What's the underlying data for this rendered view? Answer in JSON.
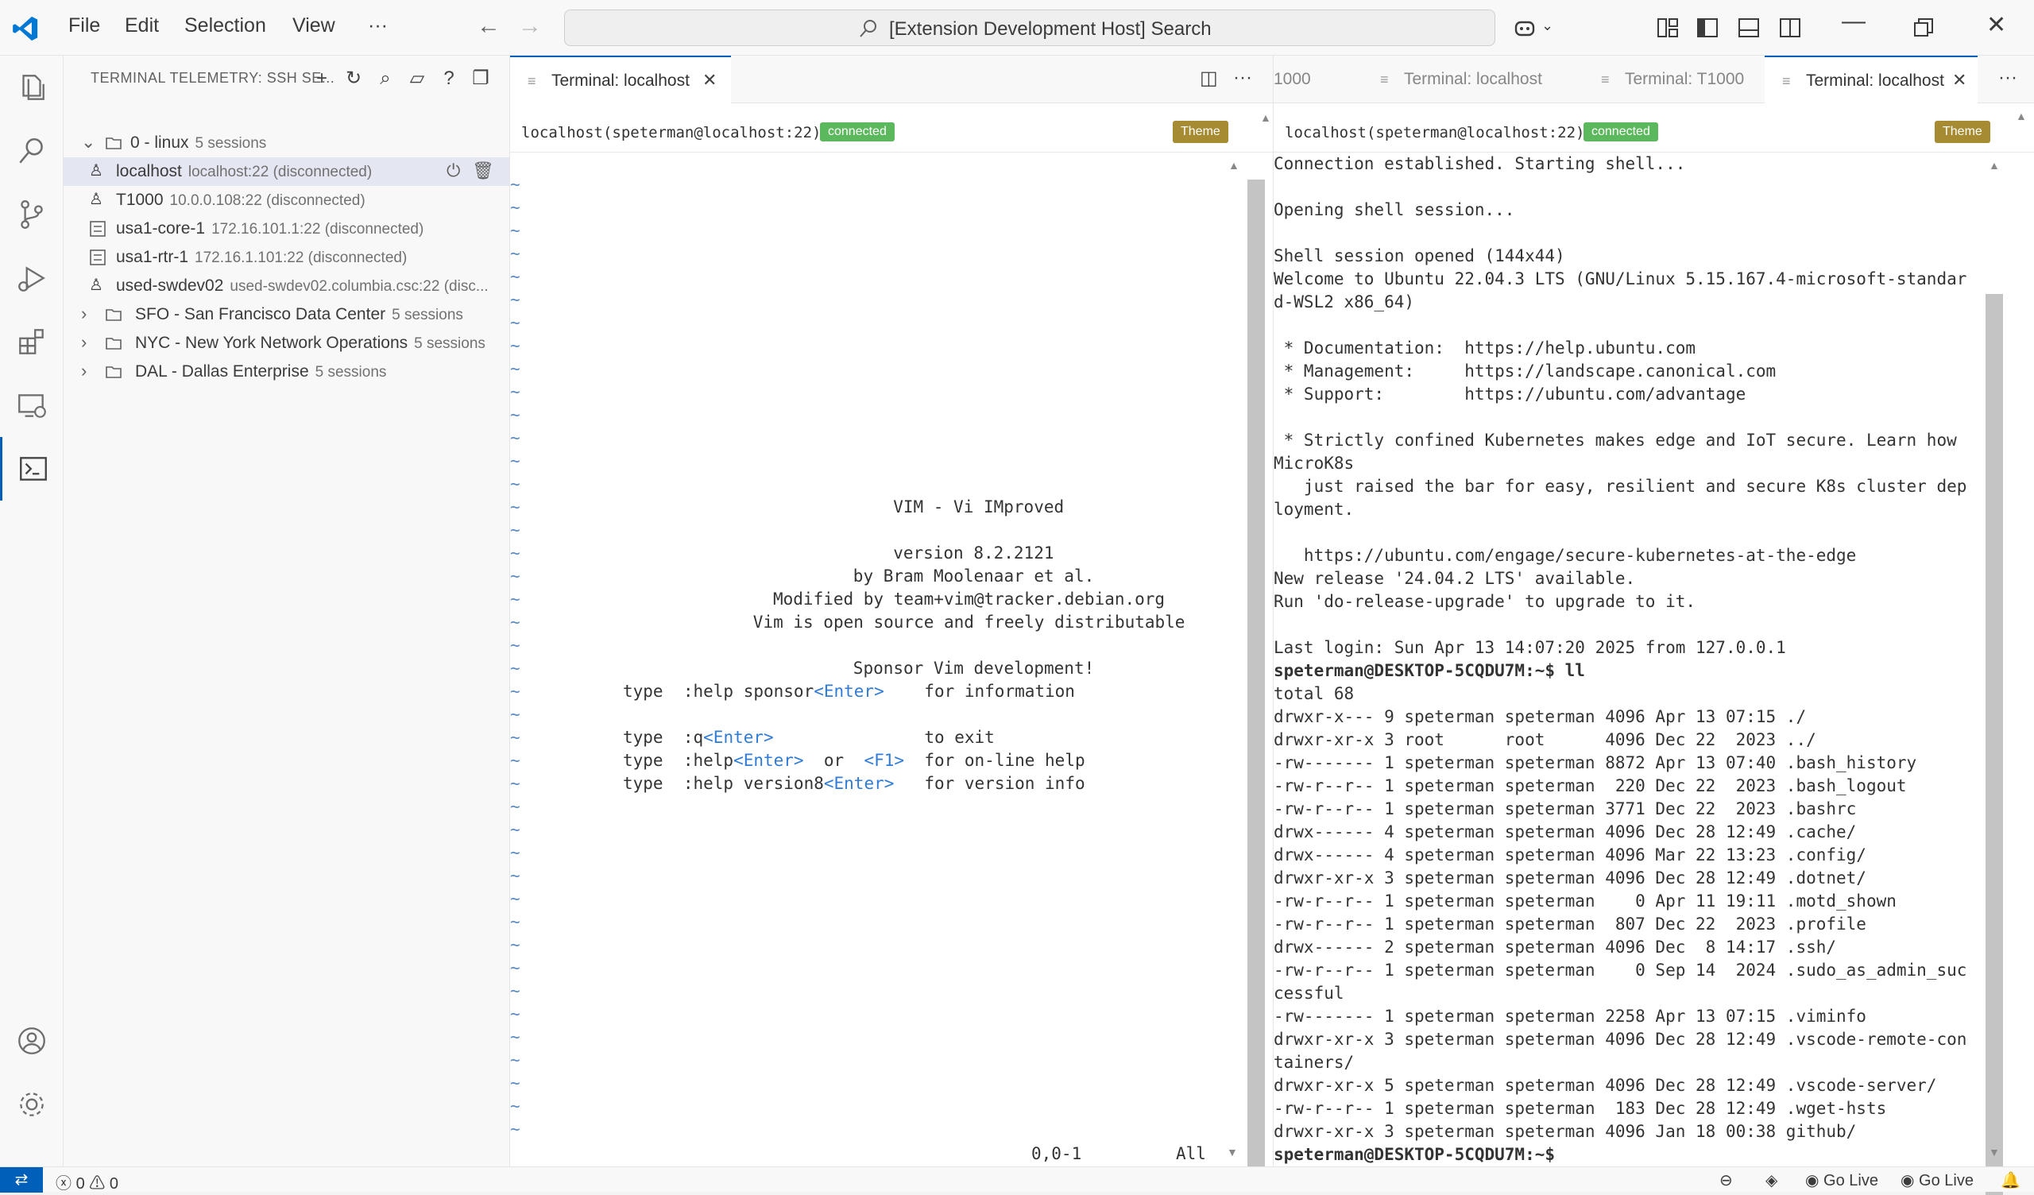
{
  "titlebar": {
    "menus": [
      "File",
      "Edit",
      "Selection",
      "View",
      "···"
    ],
    "search_text": "[Extension Development Host] Search"
  },
  "sidebar": {
    "title": "TERMINAL TELEMETRY: SSH SE...",
    "tree": [
      {
        "label": "0 - linux",
        "desc": "5 sessions",
        "type": "folder",
        "expanded": true
      },
      {
        "label": "localhost",
        "desc": "localhost:22 (disconnected)",
        "type": "linux",
        "selected": true
      },
      {
        "label": "T1000",
        "desc": "10.0.0.108:22 (disconnected)",
        "type": "linux"
      },
      {
        "label": "usa1-core-1",
        "desc": "172.16.101.1:22 (disconnected)",
        "type": "router"
      },
      {
        "label": "usa1-rtr-1",
        "desc": "172.16.1.101:22 (disconnected)",
        "type": "router"
      },
      {
        "label": "used-swdev02",
        "desc": "used-swdev02.columbia.csc:22 (disc...",
        "type": "linux"
      },
      {
        "label": "SFO - San Francisco Data Center",
        "desc": "5 sessions",
        "type": "folder"
      },
      {
        "label": "NYC - New York Network Operations",
        "desc": "5 sessions",
        "type": "folder"
      },
      {
        "label": "DAL - Dallas Enterprise",
        "desc": "5 sessions",
        "type": "folder"
      }
    ]
  },
  "left_group": {
    "tab_label": "Terminal: localhost",
    "host": "localhost(speterman@localhost:22)",
    "status": "connected",
    "theme_label": "Theme",
    "vim_lines": [
      {
        "t": "VIM - Vi IMproved",
        "pad": 27
      },
      {
        "t": "",
        "pad": 0
      },
      {
        "t": "version 8.2.2121",
        "pad": 27
      },
      {
        "t": "by Bram Moolenaar et al.",
        "pad": 23
      },
      {
        "t": "Modified by team+vim@tracker.debian.org",
        "pad": 15
      },
      {
        "t": "Vim is open source and freely distributable",
        "pad": 13
      },
      {
        "t": "",
        "pad": 0
      },
      {
        "t": "Sponsor Vim development!",
        "pad": 23
      }
    ],
    "vim_help": [
      {
        "pre": "type  :help sponsor",
        "key": "<Enter>",
        "post": "    for information"
      },
      {
        "pre": "",
        "key": "",
        "post": ""
      },
      {
        "pre": "type  :q",
        "key": "<Enter>",
        "post": "               to exit"
      },
      {
        "pre": "type  :help",
        "key": "<Enter>",
        "post": "  or  ",
        "key2": "<F1>",
        "post2": "  for on-line help"
      },
      {
        "pre": "type  :help version8",
        "key": "<Enter>",
        "post": "   for version info"
      }
    ],
    "ruler_pos": "0,0-1",
    "ruler_all": "All"
  },
  "right_group": {
    "tabs": [
      "1000",
      "Terminal: localhost",
      "Terminal: T1000",
      "Terminal: localhost"
    ],
    "host": "localhost(speterman@localhost:22)",
    "status": "connected",
    "theme_label": "Theme",
    "lines": [
      "Connection established. Starting shell...",
      "",
      "Opening shell session...",
      "",
      "Shell session opened (144x44)",
      "Welcome to Ubuntu 22.04.3 LTS (GNU/Linux 5.15.167.4-microsoft-standar",
      "d-WSL2 x86_64)",
      "",
      " * Documentation:  https://help.ubuntu.com",
      " * Management:     https://landscape.canonical.com",
      " * Support:        https://ubuntu.com/advantage",
      "",
      " * Strictly confined Kubernetes makes edge and IoT secure. Learn how",
      "MicroK8s",
      "   just raised the bar for easy, resilient and secure K8s cluster dep",
      "loyment.",
      "",
      "   https://ubuntu.com/engage/secure-kubernetes-at-the-edge",
      "New release '24.04.2 LTS' available.",
      "Run 'do-release-upgrade' to upgrade to it.",
      "",
      "Last login: Sun Apr 13 14:07:20 2025 from 127.0.0.1",
      "speterman@DESKTOP-5CQDU7M:~$ ll",
      "total 68",
      "drwxr-x--- 9 speterman speterman 4096 Apr 13 07:15 ./",
      "drwxr-xr-x 3 root      root      4096 Dec 22  2023 ../",
      "-rw------- 1 speterman speterman 8872 Apr 13 07:40 .bash_history",
      "-rw-r--r-- 1 speterman speterman  220 Dec 22  2023 .bash_logout",
      "-rw-r--r-- 1 speterman speterman 3771 Dec 22  2023 .bashrc",
      "drwx------ 4 speterman speterman 4096 Dec 28 12:49 .cache/",
      "drwx------ 4 speterman speterman 4096 Mar 22 13:23 .config/",
      "drwxr-xr-x 3 speterman speterman 4096 Dec 28 12:49 .dotnet/",
      "-rw-r--r-- 1 speterman speterman    0 Apr 11 19:11 .motd_shown",
      "-rw-r--r-- 1 speterman speterman  807 Dec 22  2023 .profile",
      "drwx------ 2 speterman speterman 4096 Dec  8 14:17 .ssh/",
      "-rw-r--r-- 1 speterman speterman    0 Sep 14  2024 .sudo_as_admin_suc",
      "cessful",
      "-rw------- 1 speterman speterman 2258 Apr 13 07:15 .viminfo",
      "drwxr-xr-x 3 speterman speterman 4096 Dec 28 12:49 .vscode-remote-con",
      "tainers/",
      "drwxr-xr-x 5 speterman speterman 4096 Dec 28 12:49 .vscode-server/",
      "-rw-r--r-- 1 speterman speterman  183 Dec 28 12:49 .wget-hsts",
      "drwxr-xr-x 3 speterman speterman 4096 Jan 18 00:38 github/",
      "speterman@DESKTOP-5CQDU7M:~$"
    ]
  },
  "statusbar": {
    "errors": "0",
    "warnings": "0",
    "go_live_1": "Go Live",
    "go_live_2": "Go Live"
  },
  "colors": {
    "accent": "#005fb8",
    "connected": "#5cb85c",
    "theme": "#a68b32",
    "vim_tilde": "#5b8cc8"
  }
}
